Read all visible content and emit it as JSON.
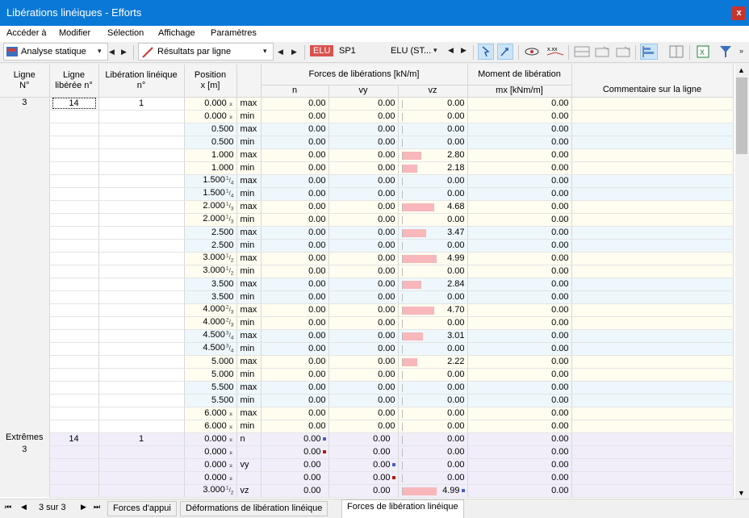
{
  "window": {
    "title": "Libérations linéiques - Efforts",
    "close": "x"
  },
  "menu": [
    "Accéder à",
    "Modifier",
    "Sélection",
    "Affichage",
    "Paramètres"
  ],
  "toolbar": {
    "analysis": "Analyse statique",
    "results": "Résultats par ligne",
    "combo_badge": "ELU",
    "combo_name": "SP1",
    "combo_type": "ELU (ST..."
  },
  "headers": {
    "ligne": "Ligne\nN°",
    "liberee": "Ligne\nlibérée n°",
    "liberation": "Libération linéique\nn°",
    "position": "Position\nx [m]",
    "forces": "Forces de libérations [kN/m]",
    "n": "n",
    "vy": "vy",
    "vz": "vz",
    "moment": "Moment de libération",
    "mx": "mx [kNm/m]",
    "comment": "Commentaire sur la ligne"
  },
  "rows": [
    {
      "pos": "0.000",
      "mk": "⌅",
      "t": "max",
      "n": "0.00",
      "vy": "0.00",
      "vz": "0.00",
      "mx": "0.00",
      "c": "y"
    },
    {
      "pos": "0.000",
      "mk": "⌅",
      "t": "min",
      "n": "0.00",
      "vy": "0.00",
      "vz": "0.00",
      "mx": "0.00",
      "c": "y"
    },
    {
      "pos": "0.500",
      "t": "max",
      "n": "0.00",
      "vy": "0.00",
      "vz": "0.00",
      "mx": "0.00",
      "c": "b"
    },
    {
      "pos": "0.500",
      "t": "min",
      "n": "0.00",
      "vy": "0.00",
      "vz": "0.00",
      "mx": "0.00",
      "c": "b"
    },
    {
      "pos": "1.000",
      "t": "max",
      "n": "0.00",
      "vy": "0.00",
      "vz": "2.80",
      "mx": "0.00",
      "c": "y"
    },
    {
      "pos": "1.000",
      "t": "min",
      "n": "0.00",
      "vy": "0.00",
      "vz": "2.18",
      "mx": "0.00",
      "c": "y"
    },
    {
      "pos": "1.500",
      "fr": "1/4",
      "t": "max",
      "n": "0.00",
      "vy": "0.00",
      "vz": "0.00",
      "mx": "0.00",
      "c": "b"
    },
    {
      "pos": "1.500",
      "fr": "1/4",
      "t": "min",
      "n": "0.00",
      "vy": "0.00",
      "vz": "0.00",
      "mx": "0.00",
      "c": "b"
    },
    {
      "pos": "2.000",
      "fr": "1/3",
      "t": "max",
      "n": "0.00",
      "vy": "0.00",
      "vz": "4.68",
      "mx": "0.00",
      "c": "y"
    },
    {
      "pos": "2.000",
      "fr": "1/3",
      "t": "min",
      "n": "0.00",
      "vy": "0.00",
      "vz": "0.00",
      "mx": "0.00",
      "c": "y"
    },
    {
      "pos": "2.500",
      "t": "max",
      "n": "0.00",
      "vy": "0.00",
      "vz": "3.47",
      "mx": "0.00",
      "c": "b"
    },
    {
      "pos": "2.500",
      "t": "min",
      "n": "0.00",
      "vy": "0.00",
      "vz": "0.00",
      "mx": "0.00",
      "c": "b"
    },
    {
      "pos": "3.000",
      "fr": "1/2",
      "t": "max",
      "n": "0.00",
      "vy": "0.00",
      "vz": "4.99",
      "mx": "0.00",
      "c": "y"
    },
    {
      "pos": "3.000",
      "fr": "1/2",
      "t": "min",
      "n": "0.00",
      "vy": "0.00",
      "vz": "0.00",
      "mx": "0.00",
      "c": "y"
    },
    {
      "pos": "3.500",
      "t": "max",
      "n": "0.00",
      "vy": "0.00",
      "vz": "2.84",
      "mx": "0.00",
      "c": "b"
    },
    {
      "pos": "3.500",
      "t": "min",
      "n": "0.00",
      "vy": "0.00",
      "vz": "0.00",
      "mx": "0.00",
      "c": "b"
    },
    {
      "pos": "4.000",
      "fr": "2/3",
      "t": "max",
      "n": "0.00",
      "vy": "0.00",
      "vz": "4.70",
      "mx": "0.00",
      "c": "y"
    },
    {
      "pos": "4.000",
      "fr": "2/3",
      "t": "min",
      "n": "0.00",
      "vy": "0.00",
      "vz": "0.00",
      "mx": "0.00",
      "c": "y"
    },
    {
      "pos": "4.500",
      "fr": "3/4",
      "t": "max",
      "n": "0.00",
      "vy": "0.00",
      "vz": "3.01",
      "mx": "0.00",
      "c": "b"
    },
    {
      "pos": "4.500",
      "fr": "3/4",
      "t": "min",
      "n": "0.00",
      "vy": "0.00",
      "vz": "0.00",
      "mx": "0.00",
      "c": "b"
    },
    {
      "pos": "5.000",
      "t": "max",
      "n": "0.00",
      "vy": "0.00",
      "vz": "2.22",
      "mx": "0.00",
      "c": "y"
    },
    {
      "pos": "5.000",
      "t": "min",
      "n": "0.00",
      "vy": "0.00",
      "vz": "0.00",
      "mx": "0.00",
      "c": "y"
    },
    {
      "pos": "5.500",
      "t": "max",
      "n": "0.00",
      "vy": "0.00",
      "vz": "0.00",
      "mx": "0.00",
      "c": "b"
    },
    {
      "pos": "5.500",
      "t": "min",
      "n": "0.00",
      "vy": "0.00",
      "vz": "0.00",
      "mx": "0.00",
      "c": "b"
    },
    {
      "pos": "6.000",
      "mk": "⌅",
      "t": "max",
      "n": "0.00",
      "vy": "0.00",
      "vz": "0.00",
      "mx": "0.00",
      "c": "y"
    },
    {
      "pos": "6.000",
      "mk": "⌅",
      "t": "min",
      "n": "0.00",
      "vy": "0.00",
      "vz": "0.00",
      "mx": "0.00",
      "c": "y"
    }
  ],
  "group1": {
    "ligne": "3",
    "liberee": "14",
    "liberation": "1"
  },
  "group2": {
    "label": "Extrêmes",
    "ligne": "3",
    "liberee": "14",
    "liberation": "1"
  },
  "extremes": [
    {
      "pos": "0.000",
      "mk": "⌅",
      "t": "n",
      "n": "0.00",
      "nmk": "#4a5cc8",
      "vy": "0.00",
      "vz": "0.00",
      "mx": "0.00"
    },
    {
      "pos": "0.000",
      "mk": "⌅",
      "t": "",
      "n": "0.00",
      "nmk": "#b01818",
      "vy": "0.00",
      "vz": "0.00",
      "mx": "0.00"
    },
    {
      "pos": "0.000",
      "mk": "⌅",
      "t": "vy",
      "n": "0.00",
      "vy": "0.00",
      "vymk": "#4a5cc8",
      "vz": "0.00",
      "mx": "0.00"
    },
    {
      "pos": "0.000",
      "mk": "⌅",
      "t": "",
      "n": "0.00",
      "vy": "0.00",
      "vymk": "#b01818",
      "vz": "0.00",
      "mx": "0.00"
    },
    {
      "pos": "3.000",
      "fr": "1/2",
      "t": "vz",
      "n": "0.00",
      "vy": "0.00",
      "vz": "4.99",
      "vzmk": "#4a5cc8",
      "mx": "0.00"
    }
  ],
  "vz_max": 4.99,
  "pager": "3 sur 3",
  "tabs": [
    "Forces d'appui",
    "Déformations de libération linéique",
    "Forces de libération linéique"
  ],
  "active_tab": 2
}
